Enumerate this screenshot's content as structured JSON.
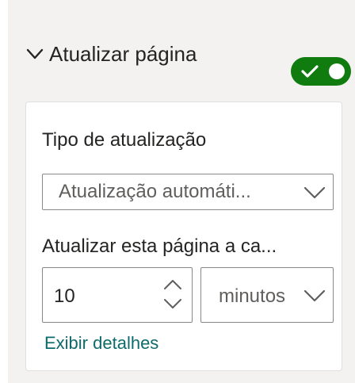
{
  "pane": {
    "section_title": "Atualizar página",
    "toggle_on": true
  },
  "card": {
    "refresh_type_label": "Tipo de atualização",
    "refresh_type_value": "Atualização automáti...",
    "interval_label": "Atualizar esta página a ca...",
    "interval_value": "10",
    "interval_unit_value": "minutos",
    "details_link": "Exibir detalhes"
  },
  "colors": {
    "toggle_on": "#107c10",
    "link": "#0e6b6b"
  },
  "icons": {
    "section_chevron": "chevron-down-icon",
    "toggle_check": "check-icon",
    "dropdown_caret": "chevron-down-icon",
    "stepper_arrows": "up-down-arrows-icon"
  }
}
